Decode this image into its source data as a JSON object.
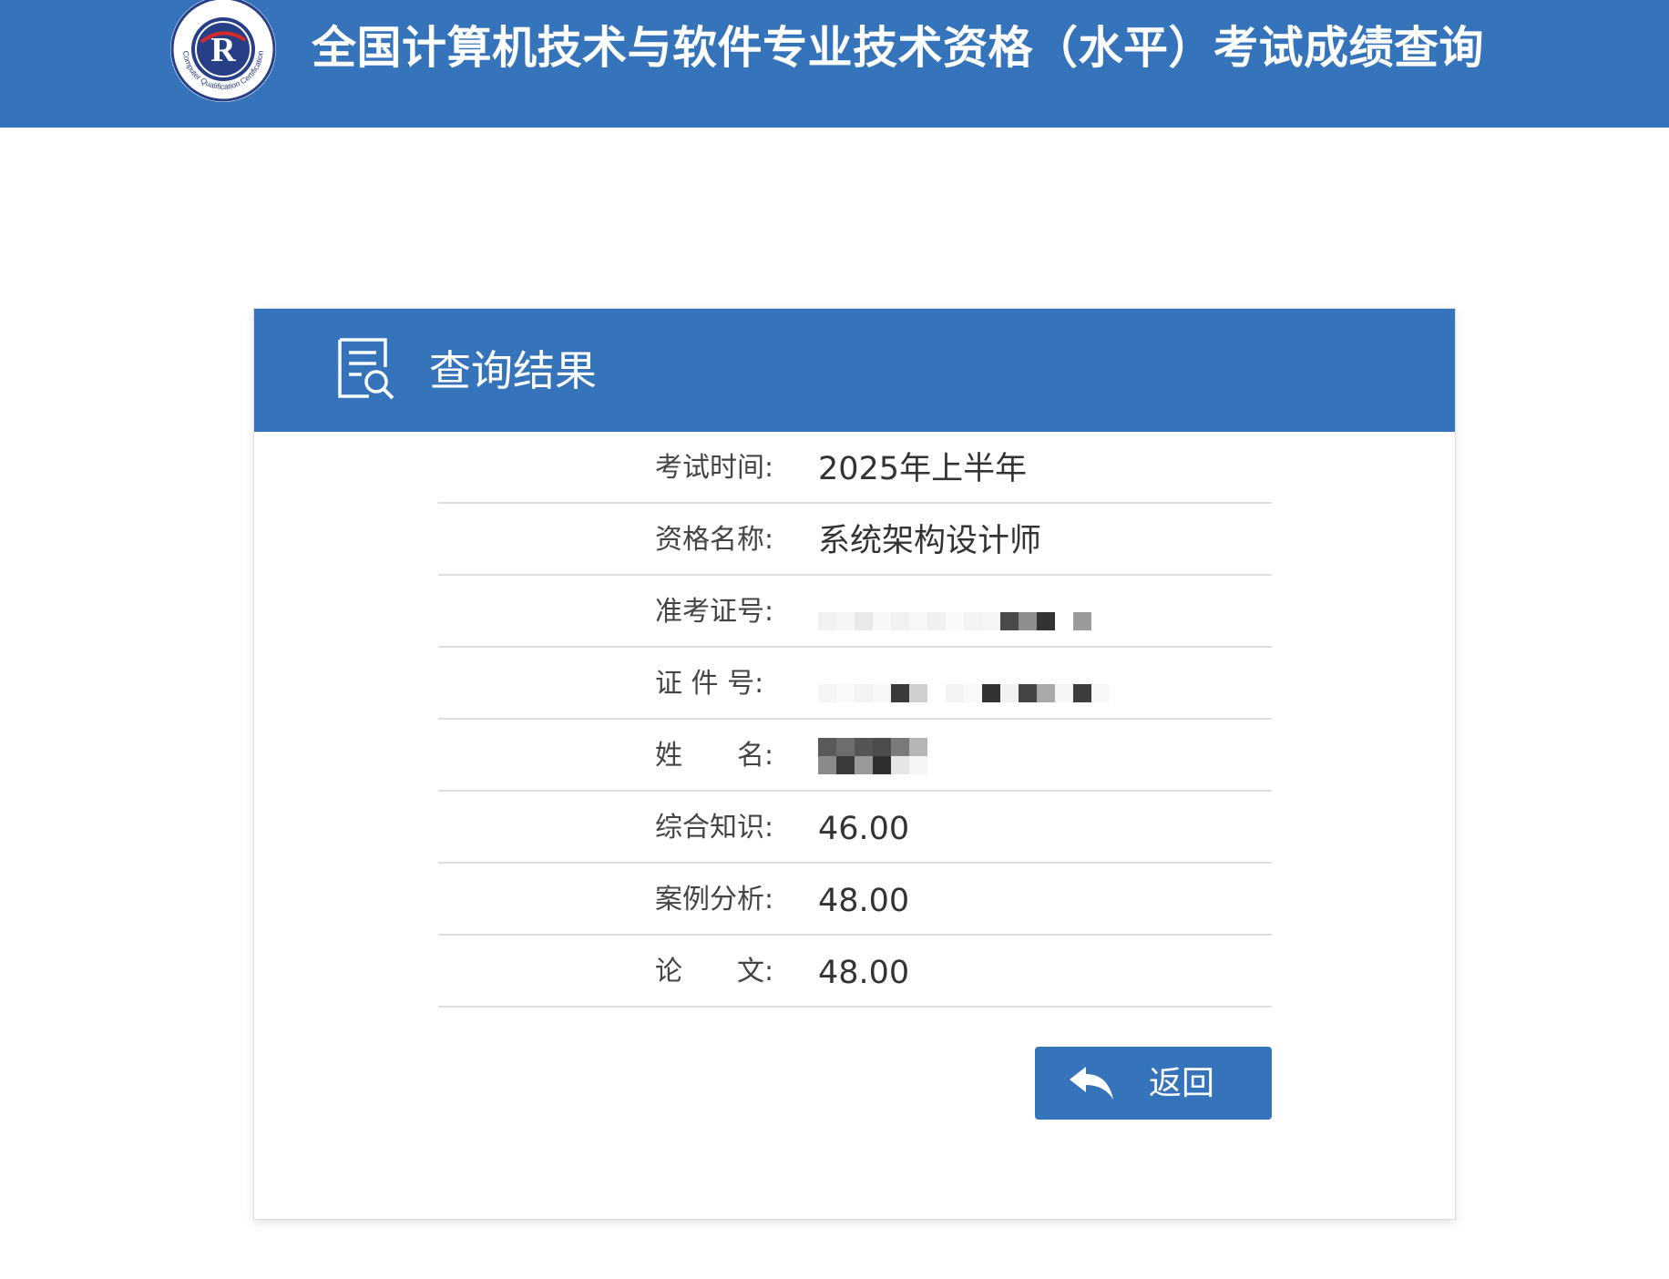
{
  "header": {
    "title": "全国计算机技术与软件专业技术资格（水平）考试成绩查询",
    "logo": {
      "icon": "ruankao-seal-logo",
      "text": "Computer Qualification Certification"
    }
  },
  "result": {
    "title": "查询结果",
    "title_icon": "document-search-icon",
    "rows": [
      {
        "label": "考试时间:",
        "value": "2025年上半年"
      },
      {
        "label": "资格名称:",
        "value": "系统架构设计师"
      },
      {
        "label": "准考证号:",
        "value": ""
      },
      {
        "label": "证 件 号:",
        "value": ""
      },
      {
        "label": "姓　　名:",
        "value": ""
      },
      {
        "label": "综合知识:",
        "value": "46.00"
      },
      {
        "label": "案例分析:",
        "value": "48.00"
      },
      {
        "label": "论　　文:",
        "value": "48.00"
      }
    ],
    "back_button": {
      "label": "返回",
      "icon": "reply-arrow-icon"
    }
  },
  "colors": {
    "brand_blue": "#3573bb",
    "divider": "#dedede",
    "label_text": "#444444",
    "value_text": "#333333"
  }
}
